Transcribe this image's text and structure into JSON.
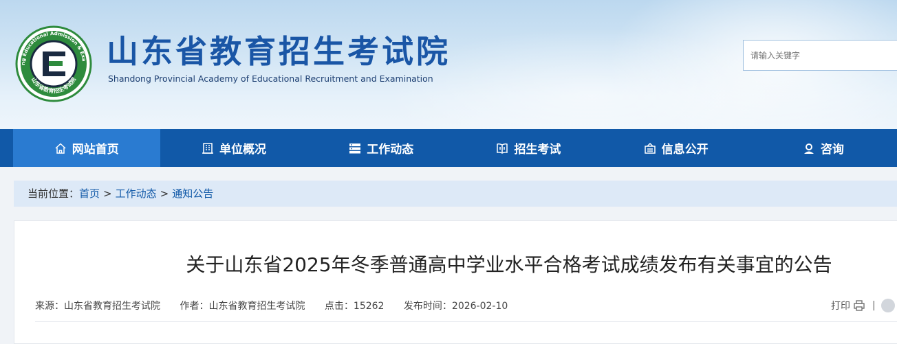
{
  "header": {
    "title": "山东省教育招生考试院",
    "subtitle": "Shandong Provincial Academy of Educational Recruitment and Examination",
    "emblem_text_top": "Shandong Educational Admission & Examination",
    "emblem_text_bottom": "山东省教育招生考试院",
    "emblem_letter": "E",
    "search_placeholder": "请输入关键字"
  },
  "nav": {
    "items": [
      {
        "label": "网站首页",
        "icon": "home-icon",
        "active": true
      },
      {
        "label": "单位概况",
        "icon": "building-icon",
        "active": false
      },
      {
        "label": "工作动态",
        "icon": "list-icon",
        "active": false
      },
      {
        "label": "招生考试",
        "icon": "book-icon",
        "active": false
      },
      {
        "label": "信息公开",
        "icon": "info-box-icon",
        "active": false
      },
      {
        "label": "咨询",
        "icon": "consult-icon",
        "active": false
      }
    ]
  },
  "breadcrumb": {
    "prefix": "当前位置：",
    "items": [
      "首页",
      "工作动态",
      "通知公告"
    ],
    "separator": ">"
  },
  "article": {
    "title": "关于山东省2025年冬季普通高中学业水平合格考试成绩发布有关事宜的公告",
    "source_label": "来源：",
    "source": "山东省教育招生考试院",
    "author_label": "作者：",
    "author": "山东省教育招生考试院",
    "clicks_label": "点击：",
    "clicks": "15262",
    "date_label": "发布时间：",
    "date": "2026-02-10",
    "print_label": "打印",
    "separator": "|"
  },
  "colors": {
    "brand_blue": "#1159a8",
    "nav_active": "#2a7bd1",
    "title_blue": "#1a56a6",
    "emblem_green": "#2e8b3d"
  }
}
